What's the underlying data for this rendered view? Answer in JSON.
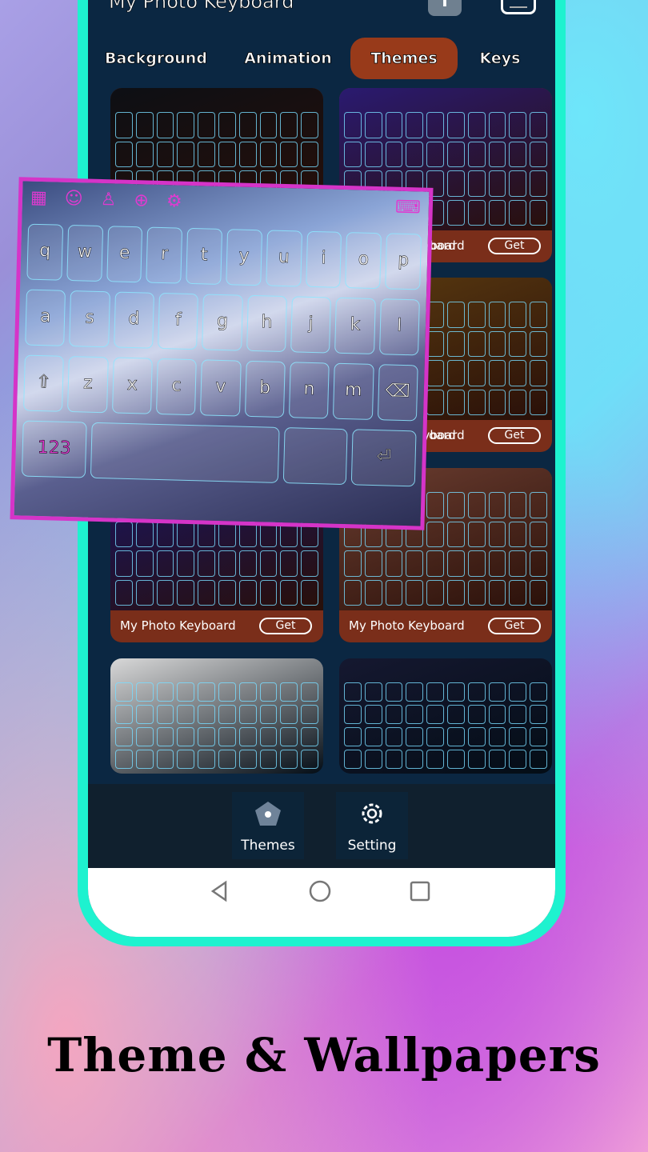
{
  "app": {
    "title": "My Photo Keyboard"
  },
  "tabs": [
    {
      "label": "Background"
    },
    {
      "label": "Animation"
    },
    {
      "label": "Themes",
      "active": true
    },
    {
      "label": "Keys"
    }
  ],
  "cards": [
    {
      "label": "",
      "get": "",
      "bg": "#0d0f14"
    },
    {
      "label": "My Photo Keyboard",
      "get": "Get",
      "bg": "#2a1a70"
    },
    {
      "label": "",
      "get": "",
      "bg": "#2a1f10"
    },
    {
      "label": "My Photo Keyboard",
      "get": "Get",
      "bg": "#5a3a10"
    },
    {
      "label": "My Photo Keyboard",
      "get": "Get",
      "bg": "#1a1560"
    },
    {
      "label": "My Photo Keyboard",
      "get": "Get",
      "bg": "#6b3d30"
    },
    {
      "label": "",
      "get": "",
      "bg": "#d8d8d8"
    },
    {
      "label": "",
      "get": "",
      "bg": "#151830"
    }
  ],
  "overlay_partial_labels": [
    "oard",
    "oard"
  ],
  "preview_keyboard": {
    "rows": [
      [
        "q",
        "w",
        "e",
        "r",
        "t",
        "y",
        "u",
        "i",
        "o",
        "p"
      ],
      [
        "a",
        "s",
        "d",
        "f",
        "g",
        "h",
        "j",
        "k",
        "l"
      ],
      [
        "⇧",
        "z",
        "x",
        "c",
        "v",
        "b",
        "n",
        "m",
        "⌫"
      ],
      [
        "123",
        "",
        "",
        "⏎"
      ]
    ],
    "toolbar_icons": [
      "apps-icon",
      "emoji-icon",
      "shirt-icon",
      "globe-icon",
      "gear-icon",
      "keyboard-icon"
    ]
  },
  "bottom_nav": [
    {
      "label": "Themes",
      "icon": "pentagon-icon"
    },
    {
      "label": "Setting",
      "icon": "gear-icon"
    }
  ],
  "caption": "Theme & Wallpapers",
  "colors": {
    "phone_frame": "#1ef2cf",
    "screen": "#0b2742",
    "tab_active": "#983a1a",
    "card_footer": "#7a2e1a",
    "preview_border": "#d534c8"
  }
}
